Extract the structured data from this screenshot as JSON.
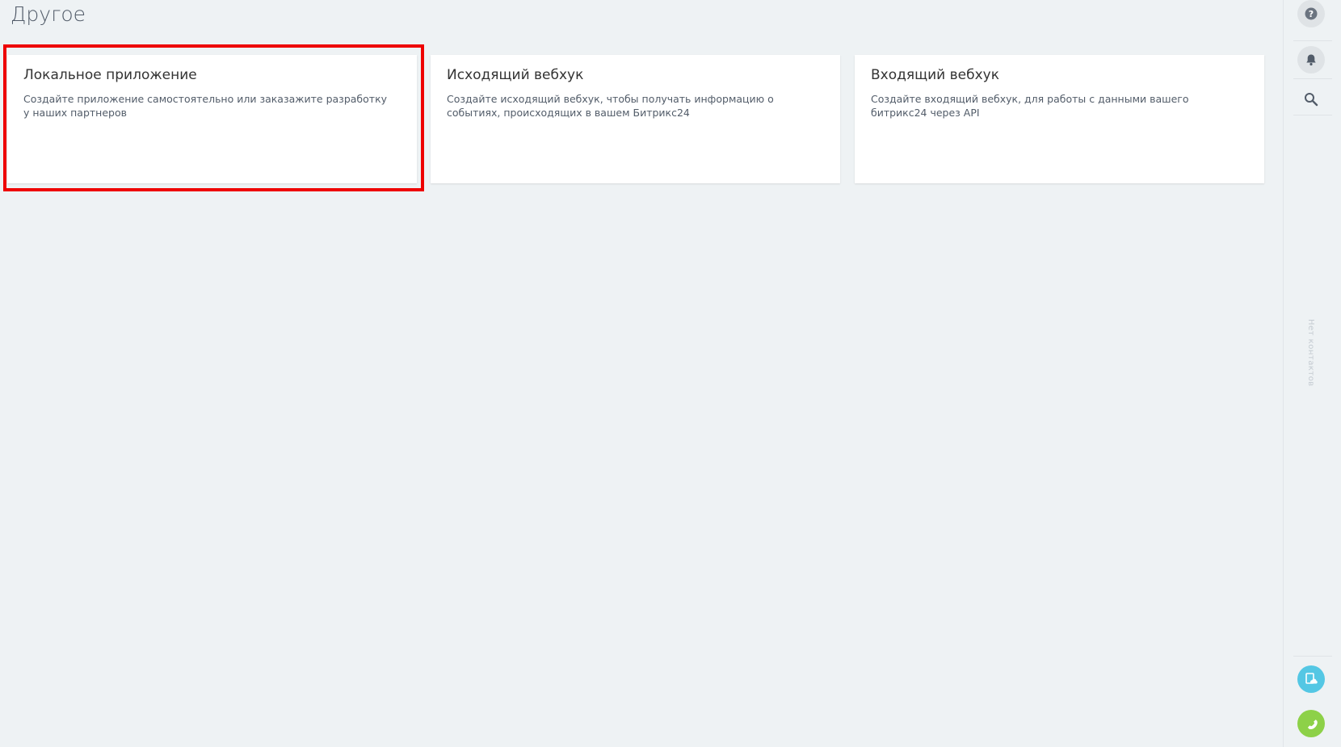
{
  "page": {
    "title": "Другое"
  },
  "cards": [
    {
      "title": "Локальное приложение",
      "description": "Создайте приложение самостоятельно или заказажите разработку у наших партнеров"
    },
    {
      "title": "Исходящий вебхук",
      "description": "Создайте исходящий вебхук, чтобы получать информацию о событиях, происходящих в вашем Битрикс24"
    },
    {
      "title": "Входящий вебхук",
      "description": "Создайте входящий вебхук, для работы с данными вашего битрикс24 через API"
    }
  ],
  "right_panel": {
    "vertical_text": "Нет контактов",
    "icons": [
      "help-icon",
      "bell-icon",
      "search-icon",
      "cloud-document-icon",
      "phone-icon"
    ]
  },
  "colors": {
    "background": "#eef2f4",
    "card": "#ffffff",
    "highlight": "#ee0000",
    "cloud_button": "#54c7e4",
    "phone_button": "#8dd148"
  }
}
